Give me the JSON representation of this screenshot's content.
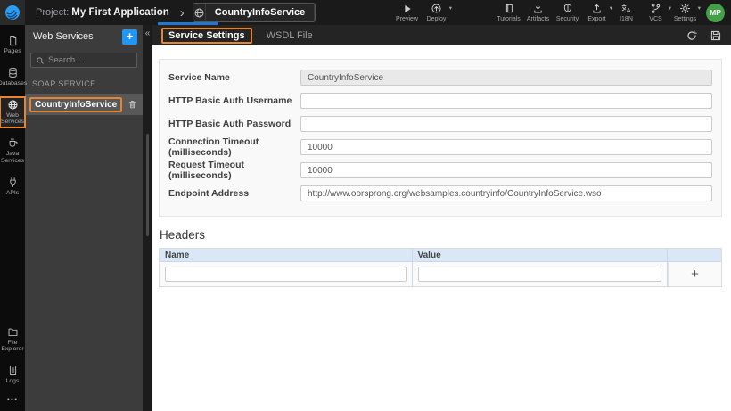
{
  "topbar": {
    "project_label": "Project:",
    "project_name": "My First Application",
    "service_tab": {
      "label": "CountryInfoService"
    },
    "left_actions": [
      {
        "label": "Preview"
      },
      {
        "label": "Deploy",
        "has_caret": true
      }
    ],
    "tutorials_label": "Tutorials",
    "right_actions": [
      {
        "label": "Artifacts"
      },
      {
        "label": "Security"
      },
      {
        "label": "Export",
        "has_caret": true
      },
      {
        "label": "I18N"
      },
      {
        "label": "VCS",
        "has_caret": true
      },
      {
        "label": "Settings",
        "has_caret": true
      }
    ],
    "avatar_initials": "MP"
  },
  "glyphs": {
    "chevron": "›",
    "caret": "▾",
    "collapse": "«",
    "more": "•••",
    "plus": "+",
    "add_row": "+"
  },
  "sidebar": {
    "items": [
      {
        "label": "Pages",
        "icon": "page-icon"
      },
      {
        "label": "Databases",
        "icon": "database-icon"
      },
      {
        "label": "Web Services",
        "icon": "globe-icon",
        "active": true
      },
      {
        "label": "Java Services",
        "icon": "coffee-icon"
      },
      {
        "label": "APIs",
        "icon": "plug-icon"
      }
    ],
    "bottom_items": [
      {
        "label": "File Explorer",
        "icon": "folder-icon"
      },
      {
        "label": "Logs",
        "icon": "log-icon"
      }
    ]
  },
  "panel": {
    "title": "Web Services",
    "search_placeholder": "Search...",
    "section_label": "SOAP SERVICE",
    "items": [
      {
        "name": "CountryInfoService"
      }
    ]
  },
  "tabs": [
    {
      "label": "Service Settings",
      "active": true
    },
    {
      "label": "WSDL File",
      "active": false
    }
  ],
  "form": {
    "fields": [
      {
        "label": "Service Name",
        "value": "CountryInfoService",
        "disabled": true
      },
      {
        "label": "HTTP Basic Auth Username",
        "value": ""
      },
      {
        "label": "HTTP Basic Auth Password",
        "value": ""
      },
      {
        "label": "Connection Timeout (milliseconds)",
        "value": "10000"
      },
      {
        "label": "Request Timeout (milliseconds)",
        "value": "10000"
      },
      {
        "label": "Endpoint Address",
        "value": "http://www.oorsprong.org/websamples.countryinfo/CountryInfoService.wso"
      }
    ]
  },
  "headers_section": {
    "title": "Headers",
    "columns": [
      "Name",
      "Value"
    ],
    "row": {
      "name": "",
      "value": ""
    }
  },
  "colors": {
    "accent_orange": "#e78430",
    "accent_blue": "#2196f3",
    "tab_indicator_blue": "#1f78d1",
    "avatar_green": "#43a047",
    "table_header_bg": "#d9e7f6"
  }
}
